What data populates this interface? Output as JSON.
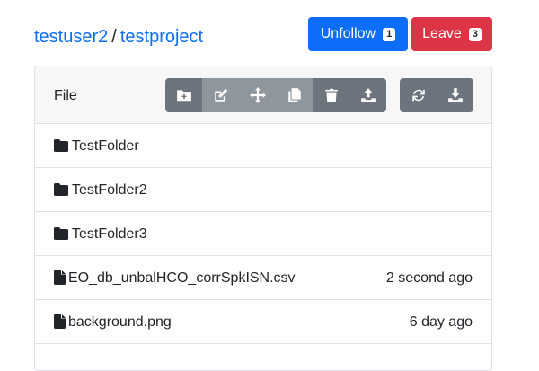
{
  "breadcrumb": {
    "user": "testuser2",
    "separator": "/",
    "project": "testproject"
  },
  "header_buttons": {
    "unfollow": {
      "label": "Unfollow",
      "count": "1",
      "color": "#0d6efd"
    },
    "leave": {
      "label": "Leave",
      "count": "3",
      "color": "#dc3545"
    }
  },
  "panel": {
    "title": "File"
  },
  "toolbar": {
    "icons": [
      "new-folder-icon",
      "edit-icon",
      "move-icon",
      "copy-icon",
      "trash-icon",
      "upload-icon",
      "refresh-icon",
      "download-icon"
    ]
  },
  "files": [
    {
      "type": "folder",
      "name": "TestFolder",
      "time": ""
    },
    {
      "type": "folder",
      "name": "TestFolder2",
      "time": ""
    },
    {
      "type": "folder",
      "name": "TestFolder3",
      "time": ""
    },
    {
      "type": "file",
      "name": "EO_db_unbalHCO_corrSpkISN.csv",
      "time": "2 second ago"
    },
    {
      "type": "file",
      "name": "background.png",
      "time": "6 day ago"
    }
  ]
}
